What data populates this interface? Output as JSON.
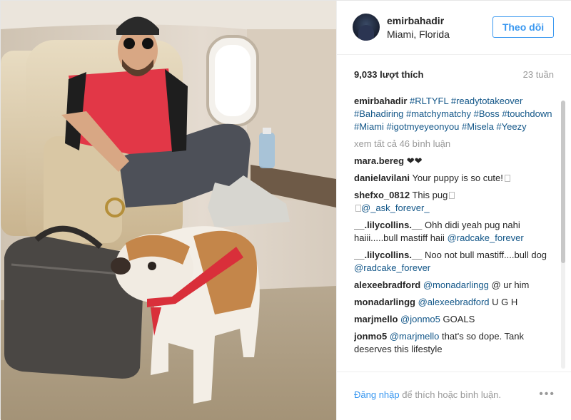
{
  "post": {
    "username": "emirbahadir",
    "location": "Miami, Florida",
    "follow_label": "Theo dõi",
    "likes": "9,033 lượt thích",
    "age": "23 tuần",
    "caption": {
      "user": "emirbahadir",
      "tags": "#RLTYFL #readytotakeover #Bahadiring #matchymatchy #Boss #touchdown #Miami #igotmyeyeonyou #Misela #Yeezy"
    },
    "view_all_comments": "xem tất cả 46 bình luận",
    "comments": [
      {
        "user": "mara.bereg",
        "text": "❤❤"
      },
      {
        "user": "danielavilani",
        "text": "Your puppy is so cute!"
      },
      {
        "user": "shefxo_0812",
        "text": "This pug",
        "mention": "@_ask_forever_"
      },
      {
        "user": "__.lilycollins.__",
        "text": "Ohh didi yeah pug nahi haiii.....bull mastiff haii",
        "mention": "@radcake_forever"
      },
      {
        "user": "__.lilycollins.__",
        "text": "Noo not bull mastiff....bull dog",
        "mention": "@radcake_forever"
      },
      {
        "user": "alexeebradford",
        "mention": "@monadarlingg",
        "text": "@ ur him"
      },
      {
        "user": "monadarlingg",
        "mention": "@alexeebradford",
        "text": "U G H"
      },
      {
        "user": "marjmello",
        "mention": "@jonmo5",
        "text": "GOALS"
      },
      {
        "user": "jonmo5",
        "mention": "@marjmello",
        "text": "that's so dope. Tank deserves this lifestyle"
      }
    ],
    "footer": {
      "login_link": "Đăng nhập",
      "login_suffix": "để thích hoặc bình luận.",
      "more": "•••"
    }
  },
  "colors": {
    "link_blue": "#3897f0",
    "tag_blue": "#125688",
    "muted": "#999999"
  }
}
